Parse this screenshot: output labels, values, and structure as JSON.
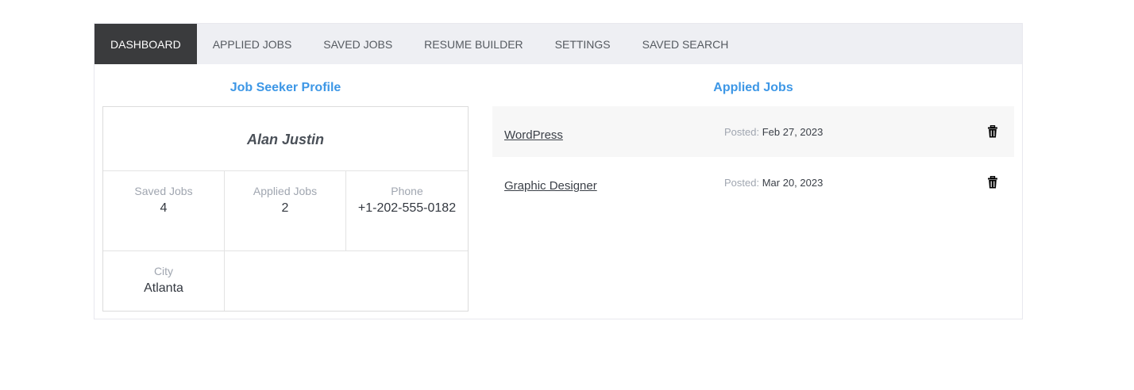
{
  "tabs": [
    {
      "label": "DASHBOARD",
      "active": true
    },
    {
      "label": "APPLIED JOBS",
      "active": false
    },
    {
      "label": "SAVED JOBS",
      "active": false
    },
    {
      "label": "RESUME BUILDER",
      "active": false
    },
    {
      "label": "SETTINGS",
      "active": false
    },
    {
      "label": "SAVED SEARCH",
      "active": false
    }
  ],
  "profile": {
    "heading": "Job Seeker Profile",
    "name": "Alan Justin",
    "saved_jobs": {
      "label": "Saved Jobs",
      "value": "4"
    },
    "applied_jobs": {
      "label": "Applied Jobs",
      "value": "2"
    },
    "phone": {
      "label": "Phone",
      "value": "+1-202-555-0182"
    },
    "city": {
      "label": "City",
      "value": "Atlanta"
    }
  },
  "applied": {
    "heading": "Applied Jobs",
    "posted_label": "Posted:",
    "jobs": [
      {
        "title": "WordPress",
        "date": "Feb 27, 2023",
        "icon": "trash-icon"
      },
      {
        "title": "Graphic Designer",
        "date": "Mar 20, 2023",
        "icon": "trash-icon"
      }
    ]
  },
  "colors": {
    "accent": "#3d97e6",
    "active_tab_bg": "#3a3b3d",
    "tab_bar_bg": "#eeeff3"
  }
}
